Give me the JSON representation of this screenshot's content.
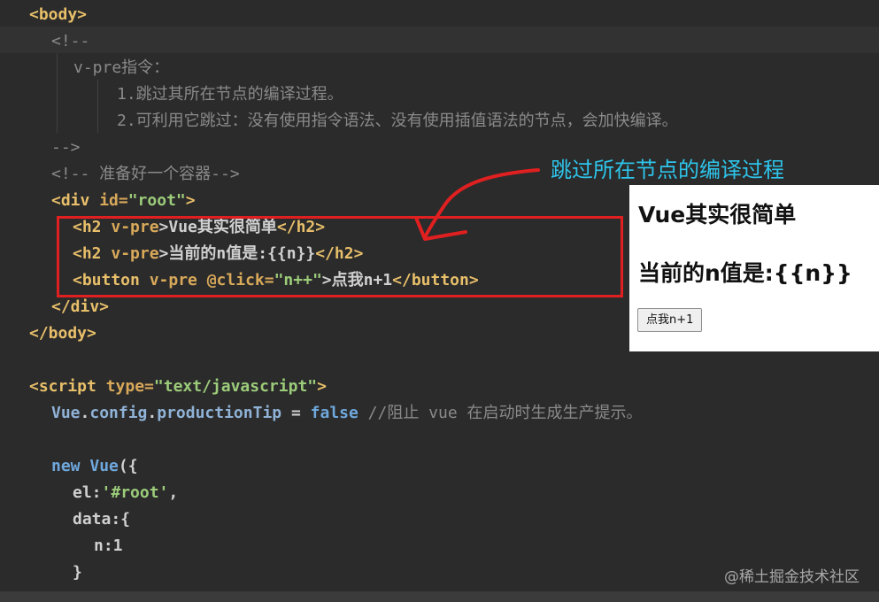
{
  "code": {
    "l1_body_open": "<body>",
    "l2_comment_open": "<!--",
    "l3_vpre_title": "v-pre指令：",
    "l4_point1": "1.跳过其所在节点的编译过程。",
    "l5_point2": "2.可利用它跳过：没有使用指令语法、没有使用插值语法的节点，会加快编译。",
    "l6_comment_close": "-->",
    "l7_comment_container": "<!-- 准备好一个容器-->",
    "l8_div_tag": "<div",
    "l8_div_attr": "id=",
    "l8_div_val": "\"root\"",
    "l8_div_end": ">",
    "l9_open": "<h2",
    "l9_attr": "v-pre",
    "l9_text": ">Vue其实很简单",
    "l9_close": "</h2>",
    "l10_open": "<h2",
    "l10_attr": "v-pre",
    "l10_text": ">当前的n值是:{{n}}",
    "l10_close": "</h2>",
    "l11_open": "<button",
    "l11_attr": "v-pre @click=",
    "l11_val": "\"n++\"",
    "l11_text": ">点我n+1",
    "l11_close": "</button>",
    "l12_div_close": "</div>",
    "l13_body_close": "</body>",
    "l15_script_tag": "<script",
    "l15_script_attr": "type=",
    "l15_script_val": "\"text/javascript\"",
    "l15_script_end": ">",
    "l16_vue": "Vue",
    "l16_dot1": ".",
    "l16_config": "config",
    "l16_dot2": ".",
    "l16_prod": "productionTip",
    "l16_eq": " = ",
    "l16_false": "false",
    "l16_comment": " //阻止 vue 在启动时生成生产提示。",
    "l18_new": "new",
    "l18_vue": "Vue",
    "l18_rest": "({",
    "l19_el_key": "el:",
    "l19_el_val": "'#root'",
    "l19_comma": ",",
    "l20_data": "data:{",
    "l21_n": "n:1",
    "l22_close": "}"
  },
  "annotation": "跳过所在节点的编译过程",
  "preview": {
    "heading1": "Vue其实很简单",
    "heading2": "当前的n值是:{{n}}",
    "button_label": "点我n+1"
  },
  "watermark": "@稀土掘金技术社区",
  "colors": {
    "editor_bg": "#2b2b2b",
    "tag": "#e8bf6a",
    "string": "#9ccc7a",
    "comment": "#8a8a8a",
    "keyword": "#6fa8dc",
    "highlight_red": "#e02020",
    "annotation_cyan": "#2ec4ea"
  }
}
